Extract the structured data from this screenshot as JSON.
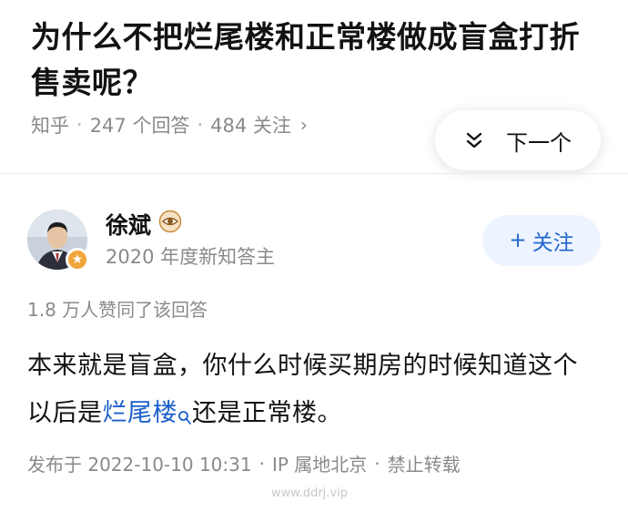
{
  "question": {
    "title": "为什么不把烂尾楼和正常楼做成盲盒打折售卖呢？",
    "source": "知乎",
    "answers_count": "247 个回答",
    "followers_count": "484 关注",
    "meta_chevron": "›"
  },
  "next_button": {
    "label": "下一个",
    "icon": "double-chevron-down-icon"
  },
  "author": {
    "name": "徐斌",
    "verified_icon": "eye-badge-icon",
    "title": "2020 年度新知答主",
    "follow_label": "关注",
    "follow_prefix": "+"
  },
  "answer": {
    "upvotes_text": "1.8 万人赞同了该回答",
    "text_before_link": "本来就是盲盒，你什么时候买期房的时候知道这个以后是",
    "link_text": "烂尾楼",
    "text_after_link": "还是正常楼。",
    "publish_date": "发布于 2022-10-10 10:31",
    "ip_location": "IP 属地北京",
    "copyright": "禁止转载"
  },
  "watermark": "www.ddrj.vip",
  "colors": {
    "accent": "#1a5fc9",
    "follow_bg": "#eef4ff",
    "meta_gray": "#8a8a8a",
    "badge": "#f1a63a"
  }
}
